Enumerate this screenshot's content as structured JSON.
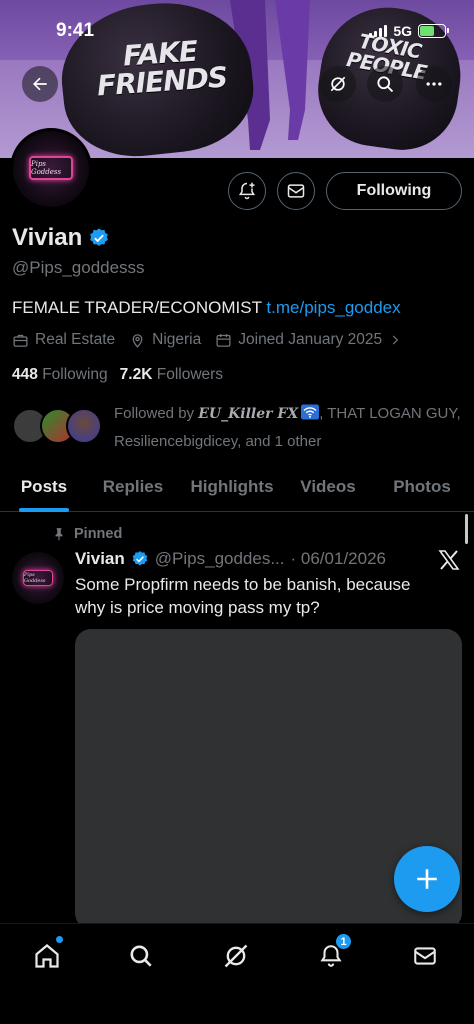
{
  "status_bar": {
    "time": "9:41",
    "network": "5G"
  },
  "banner": {
    "bag_text_left": [
      "FAKE",
      "FRIENDS"
    ],
    "bag_text_right": [
      "TOXIC",
      "PEOPLE"
    ]
  },
  "header_icons": [
    "back-arrow-icon",
    "grok-icon",
    "search-icon",
    "more-icon"
  ],
  "profile": {
    "avatar_logo_text": "Pips Goddess",
    "following_button": "Following",
    "name": "Vivian",
    "handle": "@Pips_goddesss",
    "bio_text": "FEMALE TRADER/ECONOMIST ",
    "bio_link": "t.me/pips_goddex",
    "category": "Real Estate",
    "location": "Nigeria",
    "joined": "Joined January 2025",
    "following_count": "448",
    "following_label": "Following",
    "followers_count": "7.2K",
    "followers_label": "Followers",
    "followed_by_prefix": "Followed by ",
    "followed_by_user1": "EU_Killer FX",
    "followed_by_rest": ", THAT LOGAN GUY, Resiliencebigdicey, and 1 other"
  },
  "tabs": [
    "Posts",
    "Replies",
    "Highlights",
    "Videos",
    "Photos"
  ],
  "active_tab": "Posts",
  "post": {
    "pinned_label": "Pinned",
    "author_name": "Vivian",
    "author_handle": "@Pips_goddes...",
    "date": "· 06/01/2026",
    "text": "Some Propfirm needs to be banish, because why is price moving pass my tp?"
  },
  "bottom_nav": {
    "items": [
      "home-icon",
      "search-icon",
      "grok-icon",
      "notifications-icon",
      "messages-icon"
    ],
    "notifications_badge": "1"
  },
  "colors": {
    "accent": "#1d9bf0",
    "background": "#000000",
    "muted": "#71767b",
    "text": "#e7e9ea"
  }
}
